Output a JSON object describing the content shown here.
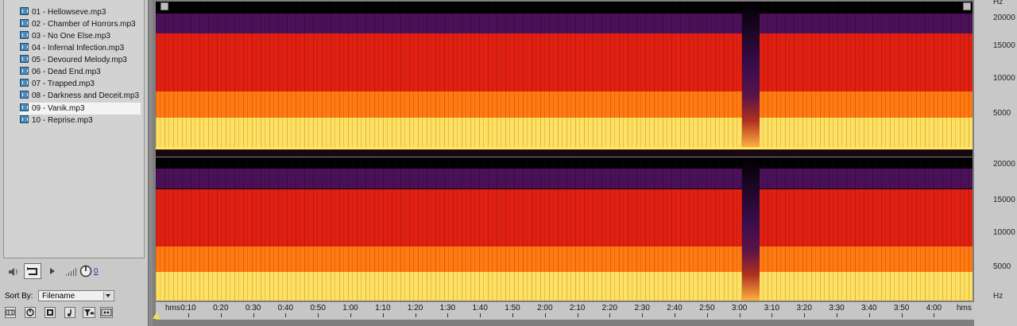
{
  "files": [
    {
      "label": "01 - Hellowseve.mp3"
    },
    {
      "label": "02 - Chamber of Horrors.mp3"
    },
    {
      "label": "03 - No One Else.mp3"
    },
    {
      "label": "04 - Infernal Infection.mp3"
    },
    {
      "label": "05 - Devoured Melody.mp3"
    },
    {
      "label": "06 - Dead End.mp3"
    },
    {
      "label": "07 - Trapped.mp3"
    },
    {
      "label": "08 - Darkness and Deceit.mp3"
    },
    {
      "label": "09 - Vanik.mp3"
    },
    {
      "label": "10 - Reprise.mp3"
    }
  ],
  "selected_file_index": 8,
  "transport": {
    "speaker_icon": "speaker-icon",
    "loop_icon": "loop-icon",
    "play_icon": "play-icon",
    "volume_icon": "volume-bars-icon",
    "knob_icon": "volume-knob-icon",
    "volume_value": "0"
  },
  "sort": {
    "label": "Sort By:",
    "value": "Filename"
  },
  "bottom_buttons": [
    {
      "icon": "grid-icon"
    },
    {
      "icon": "power-icon"
    },
    {
      "icon": "film-icon"
    },
    {
      "icon": "music-note-icon"
    },
    {
      "icon": "filter-eye-icon"
    },
    {
      "icon": "cassette-icon"
    }
  ],
  "freq_axis": {
    "unit": "Hz",
    "labels": [
      "20000",
      "15000",
      "10000",
      "5000"
    ],
    "bottom_unit": "Hz",
    "top_unit": "Hz"
  },
  "time_axis": {
    "unit_left": "hms",
    "unit_right": "hms",
    "labels": [
      "0:10",
      "0:20",
      "0:30",
      "0:40",
      "0:50",
      "1:00",
      "1:10",
      "1:20",
      "1:30",
      "1:40",
      "1:50",
      "2:00",
      "2:10",
      "2:20",
      "2:30",
      "2:40",
      "2:50",
      "3:00",
      "3:10",
      "3:20",
      "3:30",
      "3:40",
      "3:50",
      "4:00"
    ]
  },
  "colors": {
    "spec_dark": "#000000",
    "spec_purple": "#4a1058",
    "spec_red": "#e02010",
    "spec_orange": "#ff7a10",
    "spec_yellow": "#ffe060",
    "selection_bg": "#f4f4f4"
  }
}
